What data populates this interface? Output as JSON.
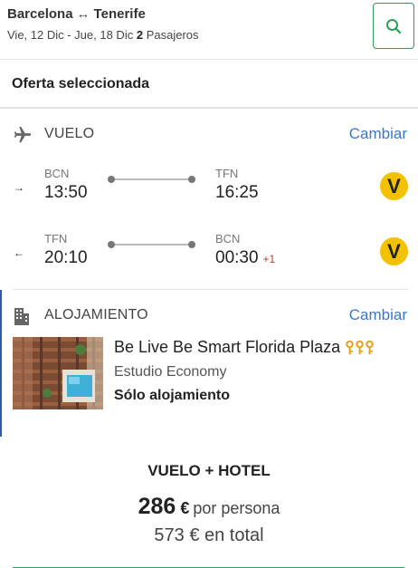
{
  "header": {
    "origin": "Barcelona",
    "destination": "Tenerife",
    "dates": "Vie, 12 Dic - Jue, 18 Dic",
    "passengers_count": "2",
    "passengers_label": "Pasajeros",
    "search_icon": "search-icon"
  },
  "offer": {
    "title": "Oferta seleccionada"
  },
  "flight": {
    "label": "VUELO",
    "change_label": "Cambiar",
    "icon": "airplane-icon",
    "legs": [
      {
        "direction": "→",
        "from_code": "BCN",
        "depart": "13:50",
        "to_code": "TFN",
        "arrive": "16:25",
        "plus_day": "",
        "airline": "V"
      },
      {
        "direction": "←",
        "from_code": "TFN",
        "depart": "20:10",
        "to_code": "BCN",
        "arrive": "00:30",
        "plus_day": "+1",
        "airline": "V"
      }
    ]
  },
  "accommodation": {
    "label": "ALOJAMIENTO",
    "change_label": "Cambiar",
    "icon": "building-icon",
    "hotel_name": "Be Live Be Smart Florida Plaza",
    "rating_keys": 3,
    "room_type": "Estudio Economy",
    "board": "Sólo alojamiento"
  },
  "summary": {
    "package": "VUELO + HOTEL",
    "per_person_amount": "286",
    "per_person_currency": "€",
    "per_person_label": "por persona",
    "total": "573 € en total"
  },
  "colors": {
    "accent_green": "#2e9c55",
    "link_blue": "#3b78c4",
    "airline_yellow": "#f2c200",
    "accent_bar": "#2a5db0"
  }
}
